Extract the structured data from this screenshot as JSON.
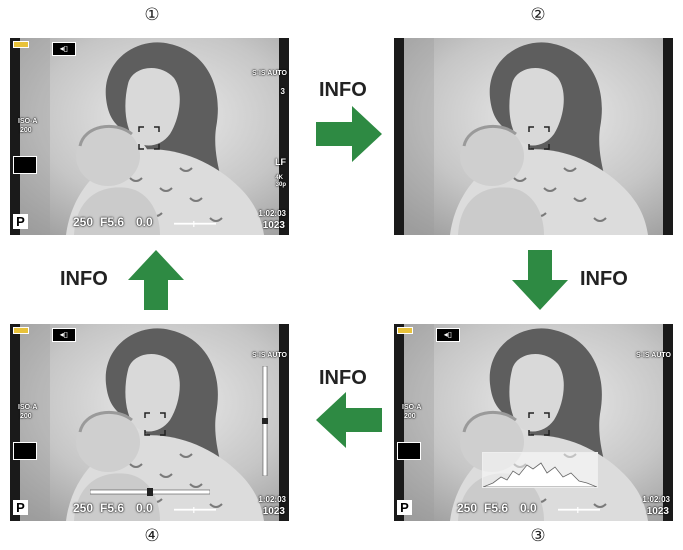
{
  "labels": {
    "step1": "①",
    "step2": "②",
    "step3": "③",
    "step4": "④",
    "info": "INFO"
  },
  "screen_text": {
    "shutter": "250",
    "aperture": "F5.6",
    "exposure_comp": "0.0",
    "mode": "P",
    "iso_label": "ISO-A",
    "iso_value": "200",
    "stabilizer": "S-IS AUTO",
    "time_remaining": "1:02:03",
    "shots_remaining": "1023",
    "picture_quality": "LF",
    "video_res": "4K",
    "video_fps": "30p",
    "drive_count": "3"
  },
  "colors": {
    "arrow": "#2e8a43",
    "battery": "#e8c23a",
    "side_bar": "#1a1a1a"
  },
  "icons": [
    "wifi-icon",
    "battery-icon",
    "af-target-icon",
    "shooting-mode-icon",
    "face-detect-icon",
    "level-gauge-icon",
    "histogram-icon",
    "arrow-right-icon",
    "arrow-down-icon",
    "arrow-left-icon",
    "arrow-up-icon"
  ]
}
